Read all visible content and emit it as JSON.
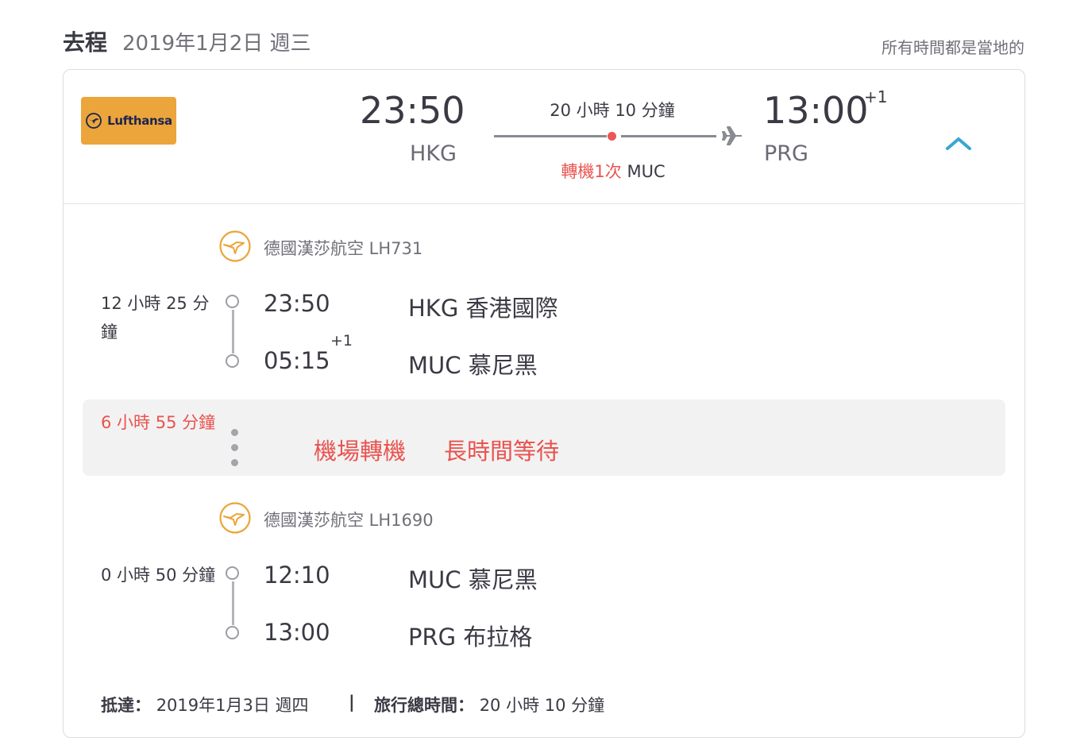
{
  "header": {
    "title": "去程",
    "date": "2019年1月2日 週三",
    "note": "所有時間都是當地的"
  },
  "summary": {
    "airline_logo_text": "Lufthansa",
    "dep_time": "23:50",
    "dep_code": "HKG",
    "duration": "20 小時 10 分鐘",
    "stops_label": "轉機1次",
    "stop_code": "MUC",
    "arr_time": "13:00",
    "arr_plus": "+1",
    "arr_code": "PRG"
  },
  "segments": [
    {
      "airline": "德國漢莎航空 LH731",
      "duration": "12 小時 25 分鐘",
      "dep_time": "23:50",
      "dep_place": "HKG 香港國際",
      "arr_time": "05:15",
      "arr_plus": "+1",
      "arr_place": "MUC 慕尼黑"
    },
    {
      "airline": "德國漢莎航空 LH1690",
      "duration": "0 小時 50 分鐘",
      "dep_time": "12:10",
      "dep_place": "MUC 慕尼黑",
      "arr_time": "13:00",
      "arr_place": "PRG 布拉格"
    }
  ],
  "layover": {
    "duration": "6 小時 55 分鐘",
    "tag1": "機場轉機",
    "tag2": "長時間等待"
  },
  "footer": {
    "arrival_label": "抵達：",
    "arrival_value": "2019年1月3日 週四",
    "separator": "|",
    "total_label": "旅行總時間：",
    "total_value": "20 小時 10 分鐘"
  },
  "colors": {
    "accent_red": "#e9534e",
    "chevron_blue": "#3aa5d2",
    "lufthansa_orange": "#eba53a"
  },
  "icons": [
    "lufthansa-crane-icon",
    "plane-icon",
    "chevron-up-icon",
    "timeline-circle-icon",
    "layover-dots-icon"
  ]
}
